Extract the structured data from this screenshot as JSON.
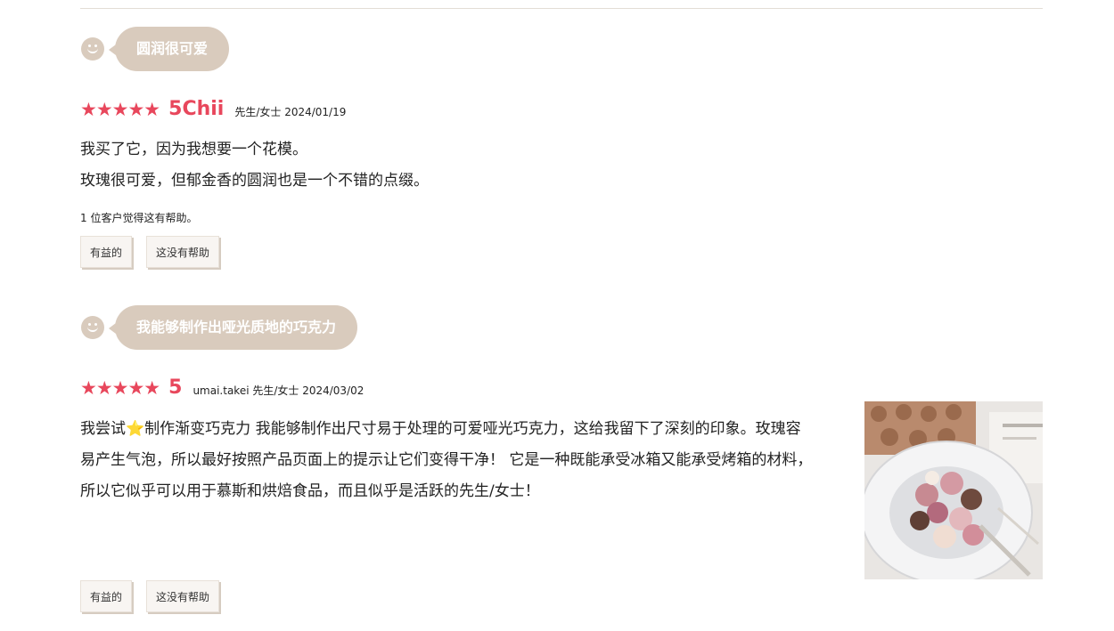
{
  "reviews": [
    {
      "title": "圆润很可爱",
      "stars": "★★★★★",
      "rating_text": "5Chii",
      "meta": "先生/女士 2024/01/19",
      "body_lines": [
        "我买了它，因为我想要一个花模。",
        "玫瑰很可爱，但郁金香的圆润也是一个不错的点缀。"
      ],
      "helpful_count": "1 位客户觉得这有帮助。",
      "helpful_label": "有益的",
      "not_helpful_label": "这没有帮助"
    },
    {
      "title": "我能够制作出哑光质地的巧克力",
      "stars": "★★★★★",
      "rating_text": "5",
      "meta": "umai.takei 先生/女士 2024/03/02",
      "body_lines": [
        "我尝试⭐制作渐变巧克力 我能够制作出尺寸易于处理的可爱哑光巧克力，这给我留下了深刻的印象。玫瑰容",
        "易产生气泡，所以最好按照产品页面上的提示让它们变得干净！ 它是一种既能承受冰箱又能承受烤箱的材料，",
        "所以它似乎可以用于慕斯和烘焙食品，而且似乎是活跃的先生/女士！"
      ],
      "helpful_label": "有益的",
      "not_helpful_label": "这没有帮助"
    }
  ]
}
